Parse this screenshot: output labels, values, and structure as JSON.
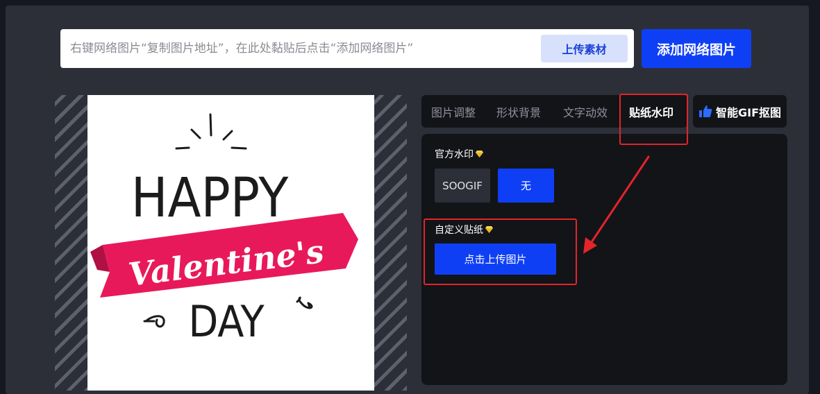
{
  "url_bar": {
    "placeholder": "右键网络图片“复制图片地址”，在此处黏贴后点击“添加网络图片”",
    "upload_material_label": "上传素材",
    "add_network_label": "添加网络图片"
  },
  "preview": {
    "headline": "HAPPY",
    "ribbon_text": "Valentine's",
    "footer_text": "DAY",
    "ribbon_color": "#e8195b"
  },
  "tabs": [
    {
      "label": "图片调整",
      "active": false
    },
    {
      "label": "形状背景",
      "active": false
    },
    {
      "label": "文字动效",
      "active": false
    },
    {
      "label": "贴纸水印",
      "active": true
    }
  ],
  "smart_gif": {
    "label": "智能GIF抠图",
    "icon": "thumbs-up-icon"
  },
  "settings": {
    "official_watermark": {
      "label": "官方水印",
      "options": [
        {
          "label": "SOOGIF",
          "selected": false
        },
        {
          "label": "无",
          "selected": true
        }
      ]
    },
    "custom_sticker": {
      "label": "自定义贴纸",
      "upload_label": "点击上传图片"
    }
  },
  "colors": {
    "accent": "#0f3ff5",
    "panel": "#2c2f38",
    "annotation": "#e3242b"
  }
}
